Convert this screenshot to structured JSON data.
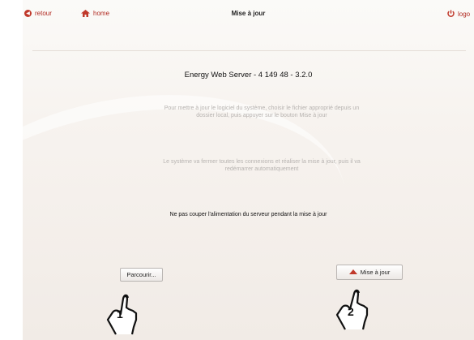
{
  "topbar": {
    "back_label": "retour",
    "home_label": "home",
    "title": "Mise à jour",
    "logout_label": "logo"
  },
  "content": {
    "server_title": "Energy Web Server - 4 149 48 - 3.2.0",
    "instruction_line1": "Pour mettre à jour le logiciel du système, choisir le fichier approprié depuis un",
    "instruction_line2": "dossier local, puis appuyer sur le bouton Mise à jour",
    "notice_line1": "Le système va fermer toutes les connexions et réaliser la mise à jour, puis il va",
    "notice_line2": "redémarrer automatiquement",
    "warning": "Ne pas couper l'alimentation du serveur pendant la mise à jour"
  },
  "buttons": {
    "browse_label": "Parcourir...",
    "update_label": "Mise à jour"
  },
  "callouts": {
    "step1": "1",
    "step2": "2"
  },
  "colors": {
    "accent": "#c0392b",
    "muted_text": "#b7b3b0"
  }
}
